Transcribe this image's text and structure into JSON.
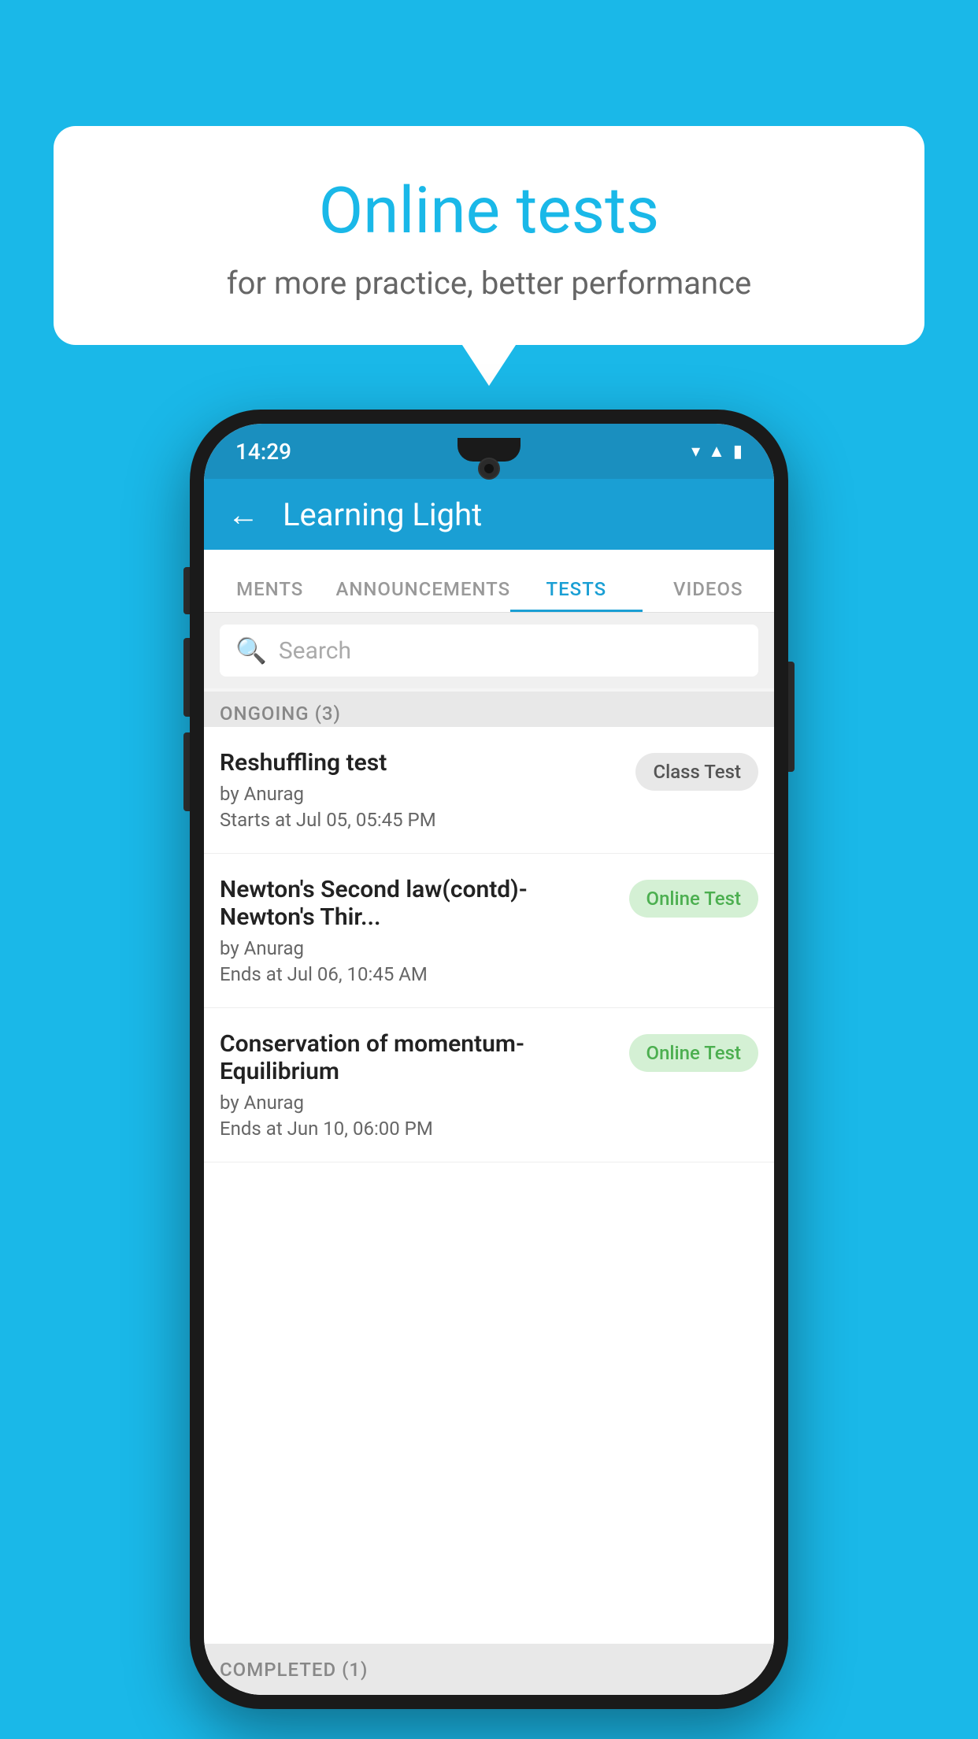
{
  "background_color": "#1ab8e8",
  "speech_bubble": {
    "title": "Online tests",
    "subtitle": "for more practice, better performance"
  },
  "phone": {
    "status_bar": {
      "time": "14:29",
      "icons": [
        "wifi",
        "signal",
        "battery"
      ]
    },
    "app_header": {
      "title": "Learning Light",
      "back_label": "←"
    },
    "tabs": [
      {
        "label": "MENTS",
        "active": false
      },
      {
        "label": "ANNOUNCEMENTS",
        "active": false
      },
      {
        "label": "TESTS",
        "active": true
      },
      {
        "label": "VIDEOS",
        "active": false
      }
    ],
    "search": {
      "placeholder": "Search"
    },
    "ongoing_section": {
      "label": "ONGOING (3)"
    },
    "tests": [
      {
        "name": "Reshuffling test",
        "author": "by Anurag",
        "date": "Starts at  Jul 05, 05:45 PM",
        "badge": "Class Test",
        "badge_type": "class"
      },
      {
        "name": "Newton's Second law(contd)-Newton's Thir...",
        "author": "by Anurag",
        "date": "Ends at  Jul 06, 10:45 AM",
        "badge": "Online Test",
        "badge_type": "online"
      },
      {
        "name": "Conservation of momentum-Equilibrium",
        "author": "by Anurag",
        "date": "Ends at  Jun 10, 06:00 PM",
        "badge": "Online Test",
        "badge_type": "online"
      }
    ],
    "completed_section": {
      "label": "COMPLETED (1)"
    }
  }
}
